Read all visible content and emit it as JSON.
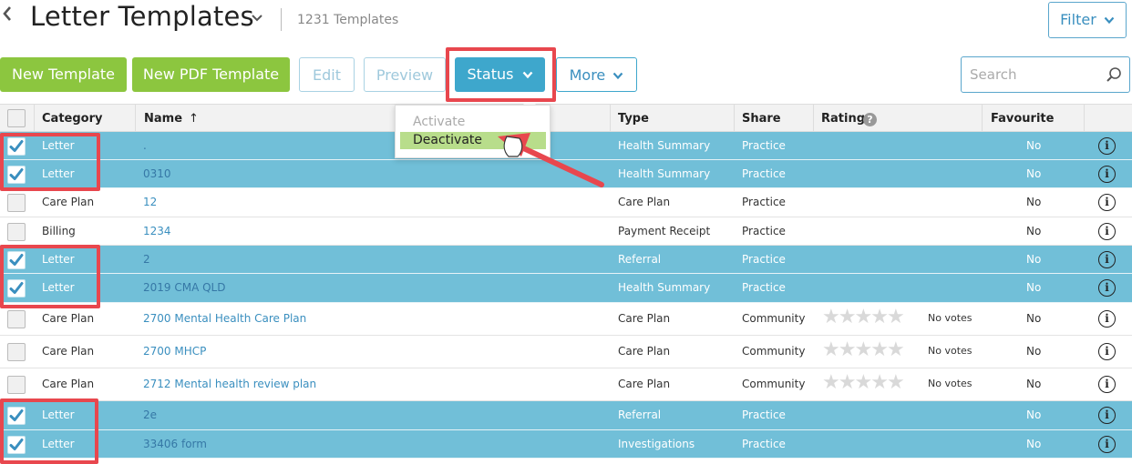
{
  "header": {
    "title": "Letter Templates",
    "count": "1231 Templates",
    "filter_label": "Filter"
  },
  "toolbar": {
    "new_template": "New Template",
    "new_pdf_template": "New PDF Template",
    "edit": "Edit",
    "preview": "Preview",
    "status": "Status",
    "more": "More",
    "search_placeholder": "Search"
  },
  "status_menu": {
    "activate": "Activate",
    "deactivate": "Deactivate"
  },
  "table": {
    "columns": {
      "category": "Category",
      "name": "Name",
      "sort_arrow": "↑",
      "type": "Type",
      "share": "Share",
      "rating": "Rating",
      "rating_help": "?",
      "favourite": "Favourite"
    },
    "rows": [
      {
        "category": "Letter",
        "name": ".",
        "type": "Health Summary",
        "share": "Practice",
        "rating": "",
        "favourite": "No",
        "selected": true
      },
      {
        "category": "Letter",
        "name": "0310",
        "type": "Health Summary",
        "share": "Practice",
        "rating": "",
        "favourite": "No",
        "selected": true
      },
      {
        "category": "Care Plan",
        "name": "12",
        "type": "Care Plan",
        "share": "Practice",
        "rating": "",
        "favourite": "No",
        "selected": false
      },
      {
        "category": "Billing",
        "name": "1234",
        "type": "Payment Receipt",
        "share": "Practice",
        "rating": "",
        "favourite": "No",
        "selected": false
      },
      {
        "category": "Letter",
        "name": "2",
        "type": "Referral",
        "share": "Practice",
        "rating": "",
        "favourite": "No",
        "selected": true
      },
      {
        "category": "Letter",
        "name": "2019 CMA QLD",
        "type": "Health Summary",
        "share": "Practice",
        "rating": "",
        "favourite": "No",
        "selected": true
      },
      {
        "category": "Care Plan",
        "name": "2700 Mental Health Care Plan",
        "type": "Care Plan",
        "share": "Community",
        "rating": "No votes",
        "favourite": "No",
        "selected": false
      },
      {
        "category": "Care Plan",
        "name": "2700 MHCP",
        "type": "Care Plan",
        "share": "Community",
        "rating": "No votes",
        "favourite": "No",
        "selected": false
      },
      {
        "category": "Care Plan",
        "name": "2712 Mental health review plan",
        "type": "Care Plan",
        "share": "Community",
        "rating": "No votes",
        "favourite": "No",
        "selected": false
      },
      {
        "category": "Letter",
        "name": "2e",
        "type": "Referral",
        "share": "Practice",
        "rating": "",
        "favourite": "No",
        "selected": true
      },
      {
        "category": "Letter",
        "name": "33406 form",
        "type": "Investigations",
        "share": "Practice",
        "rating": "",
        "favourite": "No",
        "selected": true
      }
    ]
  },
  "colors": {
    "selected_row": "#71bfd8",
    "green_button": "#8cc63f",
    "blue_button": "#3ea7cc",
    "highlight_box": "#e8474e",
    "menu_highlight": "#b8dd8b"
  }
}
